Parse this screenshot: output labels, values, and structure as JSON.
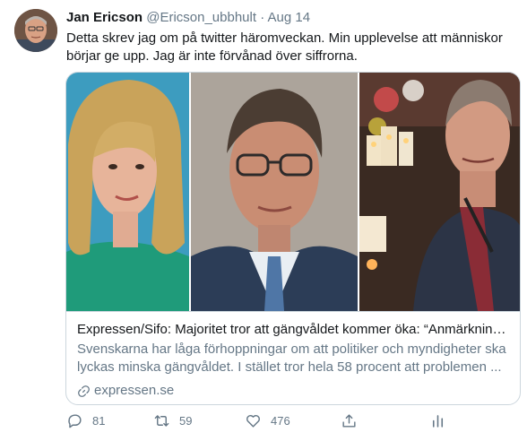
{
  "tweet": {
    "author_name": "Jan Ericson",
    "handle": "@Ericson_ubbhult",
    "separator": "·",
    "date": "Aug 14",
    "text": "Detta skrev jag om på twitter häromveckan. Min upplevelse att människor börjar ge upp. Jag är inte förvånad över siffrorna."
  },
  "card": {
    "title": "Expressen/Sifo: Majoritet tror att gängvåldet kommer öka: “Anmärkning...",
    "description": "Svenskarna har låga förhoppningar om att politiker och myndigheter ska lyckas minska gängvåldet. I stället tror hela 58 procent att problemen ...",
    "domain": "expressen.se"
  },
  "actions": {
    "reply_count": "81",
    "retweet_count": "59",
    "like_count": "476"
  },
  "colors": {
    "text_primary": "#14171a",
    "text_secondary": "#657786",
    "border": "#ccd6dd"
  },
  "icons": [
    "avatar",
    "link-icon",
    "reply-icon",
    "retweet-icon",
    "like-icon",
    "share-icon",
    "analytics-icon"
  ]
}
